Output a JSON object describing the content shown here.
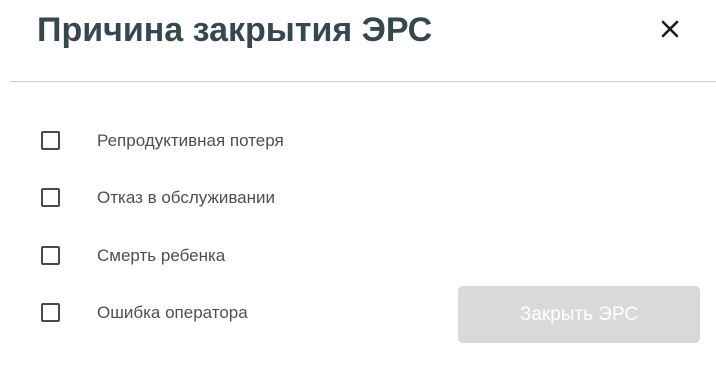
{
  "dialog": {
    "title": "Причина закрытия ЭРС",
    "close_icon": "close-icon"
  },
  "options": [
    {
      "label": "Репродуктивная потеря",
      "checked": false
    },
    {
      "label": "Отказ в обслуживании",
      "checked": false
    },
    {
      "label": "Смерть ребенка",
      "checked": false
    },
    {
      "label": "Ошибка оператора",
      "checked": false
    }
  ],
  "actions": {
    "submit_label": "Закрыть ЭРС",
    "submit_disabled": true
  },
  "colors": {
    "title": "#37474f",
    "divider": "#c9c9c9",
    "disabled_button": "#d9d9d9",
    "checkbox_border": "#4a4a4a"
  }
}
